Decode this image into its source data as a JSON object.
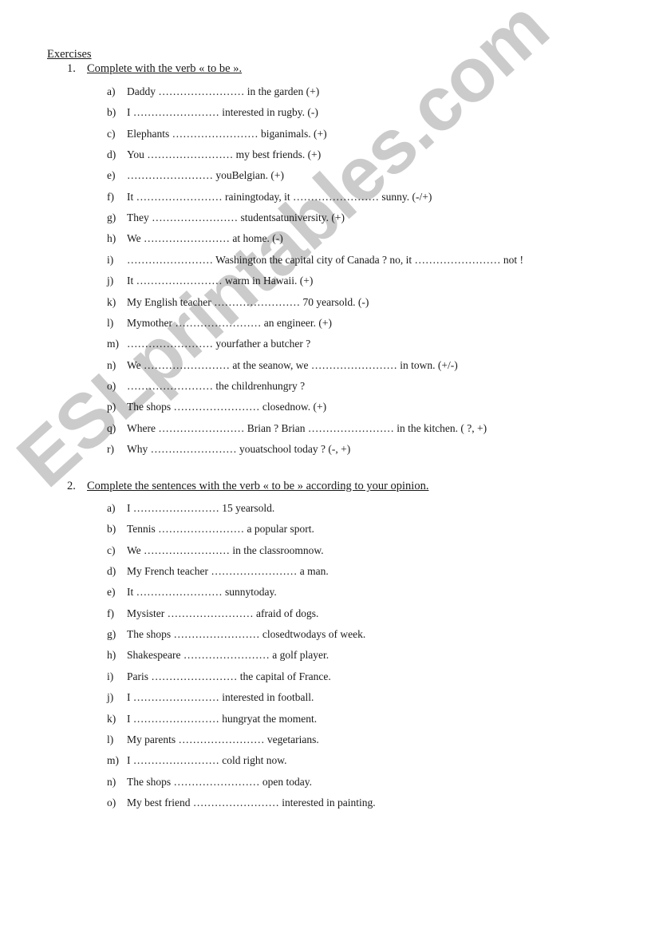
{
  "watermark": "ESLprintables.com",
  "title": "Exercises",
  "sections": [
    {
      "number": "1.",
      "heading": "Complete with the verb « to be ».",
      "items": [
        {
          "label": "a)",
          "text": "Daddy …………………… in the garden (+)"
        },
        {
          "label": "b)",
          "text": "I …………………… interested in rugby. (-)"
        },
        {
          "label": "c)",
          "text": "Elephants …………………… biganimals. (+)"
        },
        {
          "label": "d)",
          "text": "You …………………… my best friends. (+)"
        },
        {
          "label": "e)",
          "text": "…………………… youBelgian. (+)"
        },
        {
          "label": "f)",
          "text": "It …………………… rainingtoday, it …………………… sunny. (-/+)"
        },
        {
          "label": "g)",
          "text": "They …………………… studentsatuniversity. (+)"
        },
        {
          "label": "h)",
          "text": "We …………………… at home. (-)"
        },
        {
          "label": "i)",
          "text": "…………………… Washington the capital city of Canada ? no, it …………………… not !"
        },
        {
          "label": "j)",
          "text": "It …………………… warm in Hawaii. (+)"
        },
        {
          "label": "k)",
          "text": "My English teacher …………………… 70 yearsold. (-)"
        },
        {
          "label": "l)",
          "text": "Mymother …………………… an engineer. (+)"
        },
        {
          "label": "m)",
          "text": "…………………… yourfather a butcher ?"
        },
        {
          "label": "n)",
          "text": "We …………………… at the seanow, we …………………… in town. (+/-)"
        },
        {
          "label": "o)",
          "text": "…………………… the childrenhungry ?"
        },
        {
          "label": "p)",
          "text": "The shops …………………… closednow. (+)"
        },
        {
          "label": "q)",
          "text": "Where …………………… Brian ? Brian …………………… in the kitchen. ( ?, +)"
        },
        {
          "label": "r)",
          "text": "Why …………………… youatschool today ? (-, +)"
        }
      ]
    },
    {
      "number": "2.",
      "heading": "Complete the sentences with the verb « to be » according to your opinion.",
      "items": [
        {
          "label": "a)",
          "text": "I …………………… 15 yearsold."
        },
        {
          "label": "b)",
          "text": "Tennis …………………… a popular sport."
        },
        {
          "label": "c)",
          "text": "We …………………… in the classroomnow."
        },
        {
          "label": "d)",
          "text": "My French teacher …………………… a man."
        },
        {
          "label": "e)",
          "text": "It …………………… sunnytoday."
        },
        {
          "label": "f)",
          "text": "Mysister …………………… afraid of dogs."
        },
        {
          "label": "g)",
          "text": "The shops …………………… closedtwodays of week."
        },
        {
          "label": "h)",
          "text": "Shakespeare …………………… a golf player."
        },
        {
          "label": "i)",
          "text": "Paris …………………… the capital of France."
        },
        {
          "label": "j)",
          "text": "I …………………… interested in football."
        },
        {
          "label": "k)",
          "text": "I …………………… hungryat the moment."
        },
        {
          "label": "l)",
          "text": "My parents …………………… vegetarians."
        },
        {
          "label": "m)",
          "text": "I …………………… cold right now."
        },
        {
          "label": "n)",
          "text": "The shops …………………… open today."
        },
        {
          "label": "o)",
          "text": "My best friend …………………… interested in painting."
        }
      ]
    }
  ]
}
